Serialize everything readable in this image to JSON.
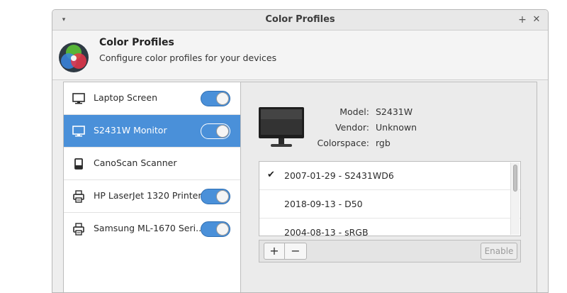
{
  "window": {
    "title": "Color Profiles",
    "menu_glyph": "▾",
    "maximize_glyph": "+",
    "close_glyph": "✕"
  },
  "header": {
    "title": "Color Profiles",
    "subtitle": "Configure color profiles for your devices",
    "icon": "color-wheel-icon"
  },
  "devices": [
    {
      "label": "Laptop Screen",
      "icon": "display-icon",
      "toggle": true,
      "selected": false
    },
    {
      "label": "S2431W Monitor",
      "icon": "display-icon",
      "toggle": true,
      "selected": true
    },
    {
      "label": "CanoScan Scanner",
      "icon": "scanner-icon",
      "toggle": false,
      "selected": false
    },
    {
      "label": "HP LaserJet 1320 Printer",
      "icon": "printer-icon",
      "toggle": true,
      "selected": false
    },
    {
      "label": "Samsung ML-1670 Seri...",
      "icon": "printer-icon",
      "toggle": true,
      "selected": false
    }
  ],
  "details": {
    "model_key": "Model:",
    "model_value": "S2431W",
    "vendor_key": "Vendor:",
    "vendor_value": "Unknown",
    "colorspace_key": "Colorspace:",
    "colorspace_value": "rgb"
  },
  "profiles": [
    {
      "label": "2007-01-29 - S2431WD6",
      "checked": true,
      "check_glyph": "✔"
    },
    {
      "label": "2018-09-13 - D50",
      "checked": false,
      "check_glyph": ""
    },
    {
      "label": "2004-08-13 - sRGB",
      "checked": false,
      "check_glyph": ""
    }
  ],
  "toolbar": {
    "add_label": "+",
    "remove_label": "−",
    "enable_label": "Enable"
  },
  "colors": {
    "accent": "#4a90d9",
    "window_bg": "#eeeeee",
    "list_bg": "#ffffff"
  }
}
